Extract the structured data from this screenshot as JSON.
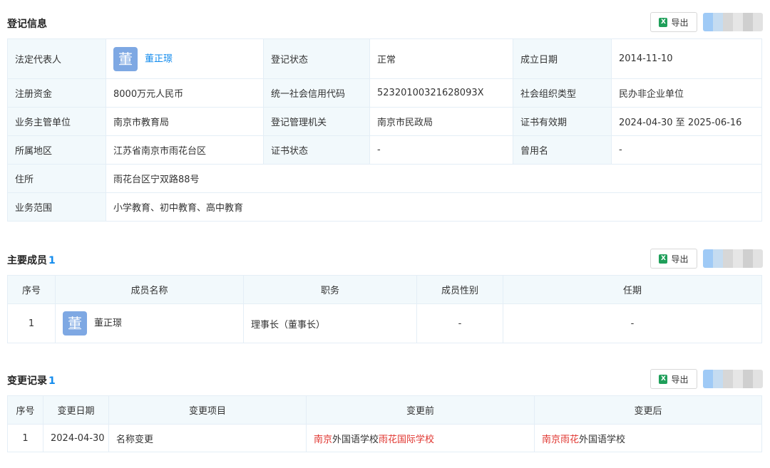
{
  "registration": {
    "title": "登记信息",
    "export_label": "导出",
    "rows": [
      [
        {
          "label": "法定代表人",
          "value": "董正璟",
          "avatar": "董"
        },
        {
          "label": "登记状态",
          "value": "正常"
        },
        {
          "label": "成立日期",
          "value": "2014-11-10"
        }
      ],
      [
        {
          "label": "注册资金",
          "value": "8000万元人民币"
        },
        {
          "label": "统一社会信用代码",
          "value": "52320100321628093X"
        },
        {
          "label": "社会组织类型",
          "value": "民办非企业单位"
        }
      ],
      [
        {
          "label": "业务主管单位",
          "value": "南京市教育局"
        },
        {
          "label": "登记管理机关",
          "value": "南京市民政局"
        },
        {
          "label": "证书有效期",
          "value": "2024-04-30 至 2025-06-16"
        }
      ],
      [
        {
          "label": "所属地区",
          "value": "江苏省南京市雨花台区"
        },
        {
          "label": "证书状态",
          "value": "-"
        },
        {
          "label": "曾用名",
          "value": "-"
        }
      ],
      [
        {
          "label": "住所",
          "value": "雨花台区宁双路88号"
        }
      ],
      [
        {
          "label": "业务范围",
          "value": "小学教育、初中教育、高中教育"
        }
      ]
    ]
  },
  "members": {
    "title": "主要成员",
    "count": "1",
    "export_label": "导出",
    "columns": [
      "序号",
      "成员名称",
      "职务",
      "成员性别",
      "任期"
    ],
    "rows": [
      {
        "index": "1",
        "avatar": "董",
        "name": "董正璟",
        "position": "理事长（董事长）",
        "gender": "-",
        "term": "-"
      }
    ]
  },
  "changes": {
    "title": "变更记录",
    "count": "1",
    "export_label": "导出",
    "columns": [
      "序号",
      "变更日期",
      "变更项目",
      "变更前",
      "变更后"
    ],
    "rows": [
      {
        "index": "1",
        "date": "2024-04-30",
        "item": "名称变更",
        "before": [
          {
            "text": "南京",
            "highlight": true
          },
          {
            "text": "外国语学校",
            "highlight": false
          },
          {
            "text": "雨花国际学校",
            "highlight": true
          }
        ],
        "after": [
          {
            "text": "南京雨花",
            "highlight": true
          },
          {
            "text": "外国语学校",
            "highlight": false
          }
        ]
      }
    ]
  },
  "colors": {
    "accent": "#128bed",
    "highlight": "#e0352f",
    "label_bg": "#f2f9fc",
    "avatar_bg": "#7ea8e3",
    "excel_green": "#1f9f5a"
  },
  "icons": {
    "export": "excel-icon",
    "avatar": "avatar-icon"
  }
}
